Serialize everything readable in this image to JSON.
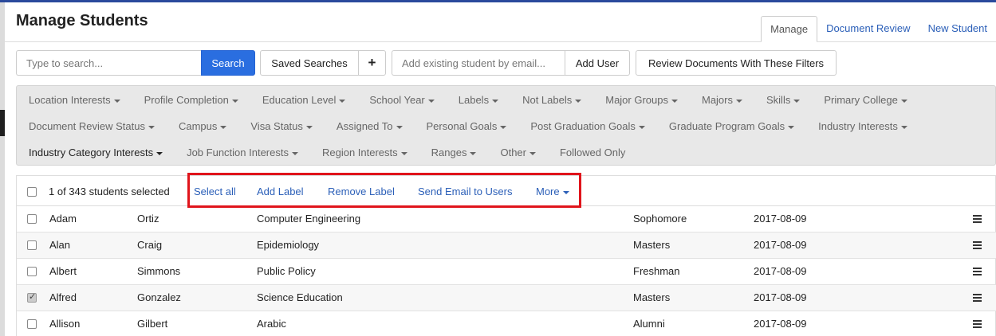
{
  "page": {
    "title": "Manage Students"
  },
  "tabs": [
    {
      "label": "Manage",
      "active": true
    },
    {
      "label": "Document Review",
      "active": false
    },
    {
      "label": "New Student",
      "active": false
    }
  ],
  "toolbar": {
    "search_placeholder": "Type to search...",
    "search_label": "Search",
    "saved_searches_label": "Saved Searches",
    "add_search_label": "+",
    "email_placeholder": "Add existing student by email...",
    "add_user_label": "Add User",
    "review_docs_label": "Review Documents With These Filters"
  },
  "filters": {
    "row1": [
      "Location Interests",
      "Profile Completion",
      "Education Level",
      "School Year",
      "Labels",
      "Not Labels",
      "Major Groups",
      "Majors",
      "Skills",
      "Primary College"
    ],
    "row2": [
      "Document Review Status",
      "Campus",
      "Visa Status",
      "Assigned To",
      "Personal Goals",
      "Post Graduation Goals",
      "Graduate Program Goals",
      "Industry Interests"
    ],
    "row3": [
      "Industry Category Interests",
      "Job Function Interests",
      "Region Interests",
      "Ranges",
      "Other"
    ],
    "followed_only": "Followed Only"
  },
  "selection": {
    "count_text": "1 of 343 students selected",
    "select_all": "Select all",
    "add_label": "Add Label",
    "remove_label": "Remove Label",
    "send_email": "Send Email to Users",
    "more": "More"
  },
  "students": [
    {
      "first": "Adam",
      "last": "Ortiz",
      "major": "Computer Engineering",
      "year": "Sophomore",
      "date": "2017-08-09",
      "checked": false
    },
    {
      "first": "Alan",
      "last": "Craig",
      "major": "Epidemiology",
      "year": "Masters",
      "date": "2017-08-09",
      "checked": false
    },
    {
      "first": "Albert",
      "last": "Simmons",
      "major": "Public Policy",
      "year": "Freshman",
      "date": "2017-08-09",
      "checked": false
    },
    {
      "first": "Alfred",
      "last": "Gonzalez",
      "major": "Science Education",
      "year": "Masters",
      "date": "2017-08-09",
      "checked": true
    },
    {
      "first": "Allison",
      "last": "Gilbert",
      "major": "Arabic",
      "year": "Alumni",
      "date": "2017-08-09",
      "checked": false
    }
  ],
  "colors": {
    "accent": "#2a6ee0",
    "link": "#2b5fb8",
    "highlight": "#e0141b",
    "topbar": "#2b4a9c"
  }
}
